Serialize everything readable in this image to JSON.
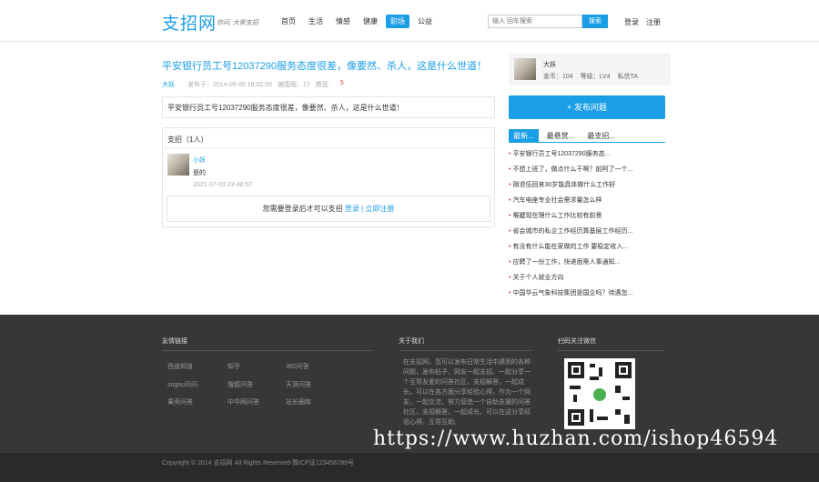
{
  "header": {
    "logo": "支招网",
    "slogan": "你问, 大家支招",
    "nav": [
      {
        "label": "首页",
        "active": false
      },
      {
        "label": "生活",
        "active": false
      },
      {
        "label": "情感",
        "active": false
      },
      {
        "label": "健康",
        "active": false
      },
      {
        "label": "职场",
        "active": true
      },
      {
        "label": "公益",
        "active": false
      }
    ],
    "search_placeholder": "输入 回车搜索",
    "search_button": "搜索",
    "login": "登录",
    "register": "注册"
  },
  "article": {
    "title": "平安银行员工号12037290服务态度很差，像要然、杀人，这是什么世道！",
    "author": "大妖",
    "published": "发布于：2014-05-05 16:02:55",
    "views": "被围观：17",
    "likes_label": "鼎签：",
    "likes_count": "5",
    "content": "平安银行员工号12037290服务态度很差，像要然、杀人，这是什么世道！"
  },
  "answers": {
    "header": "支招（1人）",
    "items": [
      {
        "user": "小妖",
        "text": "是的",
        "time": "2021-07-03 23:48:57"
      }
    ],
    "login_tip_prefix": "您需要登录后才可以支招",
    "login_link": "登录",
    "separator": " | ",
    "register_link": "立即注册"
  },
  "sidebar": {
    "user_name": "大妖",
    "coins": "金币：104",
    "level": "等级：LV4",
    "message": "私信TA",
    "ask_button": "+ 发布问题",
    "tabs": [
      {
        "label": "最新...",
        "active": true
      },
      {
        "label": "最悬赏...",
        "active": false
      },
      {
        "label": "最支招...",
        "active": false
      }
    ],
    "questions": [
      "平安银行员工号12037290服务态...",
      "不想上班了，做点什么干啊？前阿了一个...",
      "刚退伍回来30岁能具体做什么工作好",
      "汽车电座专业社会需求量怎么样",
      "喉腱现在理什么工作比较有前景",
      "省会城市的私企工作经历算基层工作经历...",
      "有没有什么能在家做的工作 要稳定收入...",
      "应聘了一份工作，快递面需人事通知...",
      "关于个人就业方向",
      "中国华云气象科技集团是国企吗？待遇怎..."
    ]
  },
  "footer": {
    "friends_title": "友情链接",
    "friends_links": [
      "西道知道",
      "知乎",
      "360问答",
      "sogou问问",
      "搜狐问答",
      "天涯问答",
      "果壳问答",
      "中华网问答",
      "站长圈库"
    ],
    "about_title": "关于我们",
    "about_text": "在支招网，您可以发布日常生活中遇到的各种问题，发布帖子、网友一起支招、一起分享一个互帮友爱的问答社区，支招解答，一起成长。可以在各方面分享经验心得，作为一个网友，一起交流，努力营造一个自助支援的问答社区，支招解答，一起成长。可以在这分享经验心得，互帮互助。",
    "qr_title": "扫码关注微信",
    "copyright": "Copyright © 2014 支招网 All Rights Reserved-豫ICP证123456789号",
    "watermark": "https://www.huzhan.com/ishop46594"
  },
  "colors": {
    "accent": "#1a9ee6",
    "footer_bg": "#373737",
    "highlight": "#e03a3a"
  }
}
